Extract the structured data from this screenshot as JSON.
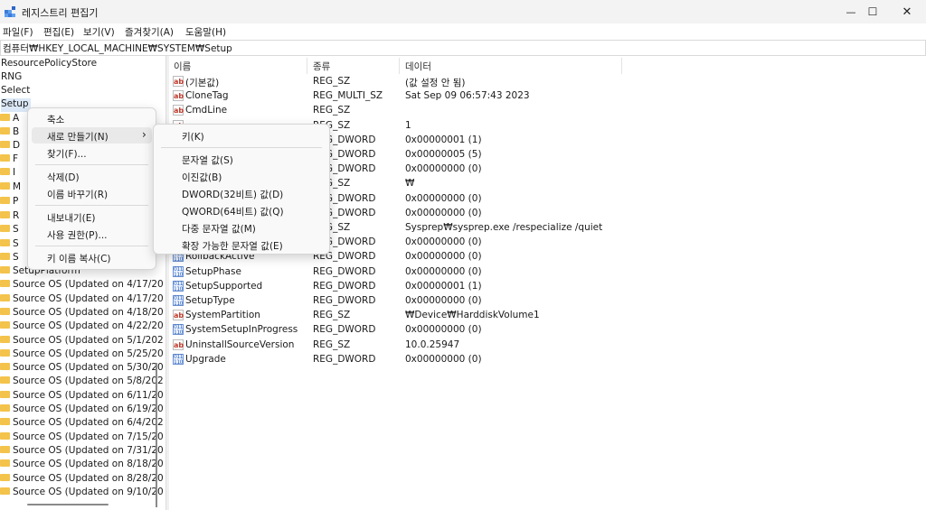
{
  "window": {
    "title": "레지스트리 편집기",
    "minimize_glyph": "—",
    "maximize_glyph": "☐",
    "close_glyph": "✕"
  },
  "menu": [
    "파일(F)",
    "편집(E)",
    "보기(V)",
    "즐겨찾기(A)",
    "도움말(H)"
  ],
  "address": "컴퓨터₩HKEY_LOCAL_MACHINE₩SYSTEM₩Setup",
  "tree": {
    "top_items": [
      "ResourcePolicyStore",
      "RNG",
      "Select",
      "Setup"
    ],
    "hidden_letters": [
      "A",
      "B",
      "D",
      "F",
      "I",
      "M",
      "P",
      "R",
      "S",
      "S",
      "S"
    ],
    "items_below": [
      "SetupPlatform",
      "Source OS (Updated on 4/17/20",
      "Source OS (Updated on 4/17/20",
      "Source OS (Updated on 4/18/20",
      "Source OS (Updated on 4/22/20",
      "Source OS (Updated on 5/1/202",
      "Source OS (Updated on 5/25/20",
      "Source OS (Updated on 5/30/20",
      "Source OS (Updated on 5/8/202",
      "Source OS (Updated on 6/11/20",
      "Source OS (Updated on 6/19/20",
      "Source OS (Updated on 6/4/202",
      "Source OS (Updated on 7/15/20",
      "Source OS (Updated on 7/31/20",
      "Source OS (Updated on 8/18/20",
      "Source OS (Updated on 8/28/20",
      "Source OS (Updated on 9/10/20"
    ]
  },
  "columns": {
    "name": "이름",
    "type": "종류",
    "data": "데이터"
  },
  "values": [
    {
      "icon": "ab",
      "name": "(기본값)",
      "type": "REG_SZ",
      "data": "(값 설정 안 됨)"
    },
    {
      "icon": "ab",
      "name": "CloneTag",
      "type": "REG_MULTI_SZ",
      "data": "Sat Sep 09 06:57:43 2023"
    },
    {
      "icon": "ab",
      "name": "CmdLine",
      "type": "REG_SZ",
      "data": ""
    },
    {
      "icon": "ab",
      "name": "",
      "type": "REG_SZ",
      "data": "1"
    },
    {
      "icon": "bin",
      "name": "",
      "type": "REG_DWORD",
      "data": "0x00000001 (1)"
    },
    {
      "icon": "bin",
      "name": "",
      "type": "REG_DWORD",
      "data": "0x00000005 (5)"
    },
    {
      "icon": "bin",
      "name": "",
      "type": "REG_DWORD",
      "data": "0x00000000 (0)"
    },
    {
      "icon": "ab",
      "name": "",
      "type": "REG_SZ",
      "data": "₩"
    },
    {
      "icon": "bin",
      "name": "",
      "type": "REG_DWORD",
      "data": "0x00000000 (0)"
    },
    {
      "icon": "bin",
      "name": "",
      "type": "REG_DWORD",
      "data": "0x00000000 (0)"
    },
    {
      "icon": "ab",
      "name": "",
      "type": "REG_SZ",
      "data": "Sysprep₩sysprep.exe /respecialize /quiet"
    },
    {
      "icon": "bin",
      "name": "",
      "type": "REG_DWORD",
      "data": "0x00000000 (0)"
    },
    {
      "icon": "bin",
      "name": "RollbackActive",
      "type": "REG_DWORD",
      "data": "0x00000000 (0)"
    },
    {
      "icon": "bin",
      "name": "SetupPhase",
      "type": "REG_DWORD",
      "data": "0x00000000 (0)"
    },
    {
      "icon": "bin",
      "name": "SetupSupported",
      "type": "REG_DWORD",
      "data": "0x00000001 (1)"
    },
    {
      "icon": "bin",
      "name": "SetupType",
      "type": "REG_DWORD",
      "data": "0x00000000 (0)"
    },
    {
      "icon": "ab",
      "name": "SystemPartition",
      "type": "REG_SZ",
      "data": "₩Device₩HarddiskVolume1"
    },
    {
      "icon": "bin",
      "name": "SystemSetupInProgress",
      "type": "REG_DWORD",
      "data": "0x00000000 (0)"
    },
    {
      "icon": "ab",
      "name": "UninstallSourceVersion",
      "type": "REG_SZ",
      "data": "10.0.25947"
    },
    {
      "icon": "bin",
      "name": "Upgrade",
      "type": "REG_DWORD",
      "data": "0x00000000 (0)"
    }
  ],
  "context_menu": {
    "items": [
      "축소",
      "새로 만들기(N)",
      "찾기(F)...",
      "삭제(D)",
      "이름 바꾸기(R)",
      "내보내기(E)",
      "사용 권한(P)...",
      "키 이름 복사(C)"
    ],
    "submenu_arrow": "›"
  },
  "submenu": {
    "items": [
      "키(K)",
      "문자열 값(S)",
      "이진값(B)",
      "DWORD(32비트) 값(D)",
      "QWORD(64비트) 값(Q)",
      "다중 문자열 값(M)",
      "확장 가능한 문자열 값(E)"
    ]
  }
}
